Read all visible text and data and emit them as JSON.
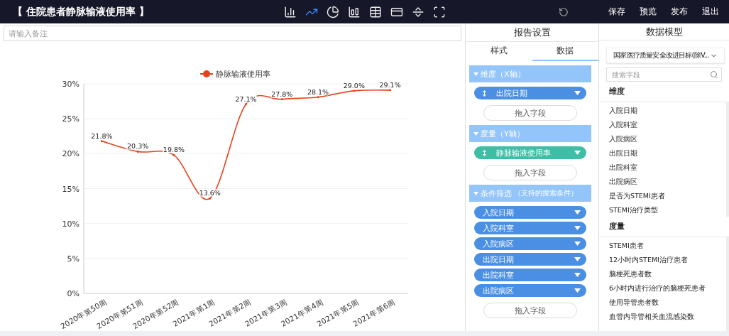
{
  "header": {
    "title": "【 住院患者静脉输液使用率 】",
    "toolbar_icons": [
      {
        "kind": "bar",
        "selected": false
      },
      {
        "kind": "line",
        "selected": true
      },
      {
        "kind": "pie",
        "selected": false
      },
      {
        "kind": "combo",
        "selected": false
      },
      {
        "kind": "table",
        "selected": false
      },
      {
        "kind": "card",
        "selected": false
      },
      {
        "kind": "split",
        "selected": false
      },
      {
        "kind": "frame",
        "selected": false
      }
    ],
    "actions": [
      "保存",
      "预览",
      "发布",
      "退出"
    ]
  },
  "remark": {
    "placeholder": "请输入备注"
  },
  "chart": {
    "chart_data": {
      "type": "line",
      "categories": [
        "2020年第50周",
        "2020年第51周",
        "2020年第52周",
        "2021年第1周",
        "2021年第2周",
        "2021年第3周",
        "2021年第4周",
        "2021年第5周",
        "2021年第6周"
      ],
      "series": [
        {
          "name": "静脉输液使用率",
          "color": "#e8401c",
          "values": [
            21.8,
            20.3,
            19.8,
            13.6,
            27.1,
            27.8,
            28.1,
            29.0,
            29.1
          ]
        }
      ],
      "ylim": [
        0,
        30
      ],
      "yticks": [
        {
          "value": 0,
          "label": "0%"
        },
        {
          "value": 5,
          "label": "5%"
        },
        {
          "value": 10,
          "label": "10%"
        },
        {
          "value": 15,
          "label": "15%"
        },
        {
          "value": 20,
          "label": "20%"
        },
        {
          "value": 25,
          "label": "25%"
        },
        {
          "value": 30,
          "label": "30%"
        }
      ],
      "grid": true,
      "value_labels": [
        "21.8%",
        "20.3%",
        "19.8%",
        "13.6%",
        "27.1%",
        "27.8%",
        "28.1%",
        "29.0%",
        "29.1%"
      ]
    }
  },
  "report_settings": {
    "title": "报告设置",
    "tabs": [
      {
        "label": "样式",
        "selected": false
      },
      {
        "label": "数据",
        "selected": true
      }
    ],
    "sections": [
      {
        "title": "维度（X轴）",
        "fields": [
          {
            "label": "出院日期",
            "kind": "dimension",
            "handle": true
          }
        ],
        "drop": "拖入字段"
      },
      {
        "title": "度量（Y轴）",
        "fields": [
          {
            "label": "静脉输液使用率",
            "kind": "measure",
            "handle": true
          }
        ],
        "drop": "拖入字段"
      },
      {
        "title": "条件筛选",
        "note": "（支持的搜索条件）",
        "fields": [
          {
            "label": "入院日期",
            "kind": "dimension",
            "handle": false
          },
          {
            "label": "入院科室",
            "kind": "dimension",
            "handle": false
          },
          {
            "label": "入院病区",
            "kind": "dimension",
            "handle": false
          },
          {
            "label": "出院日期",
            "kind": "dimension",
            "handle": false
          },
          {
            "label": "出院科室",
            "kind": "dimension",
            "handle": false
          },
          {
            "label": "出院病区",
            "kind": "dimension",
            "handle": false
          }
        ],
        "drop": "拖入字段"
      }
    ]
  },
  "data_model": {
    "title": "数据模型",
    "source": "国家医疗质量安全改进目标(除V...",
    "search": {
      "placeholder": "搜索字段"
    },
    "groups": [
      {
        "title": "维度",
        "items": [
          "入院日期",
          "入院科室",
          "入院病区",
          "出院日期",
          "出院科室",
          "出院病区",
          "是否为STEMI患者",
          "STEMI治疗类型"
        ]
      },
      {
        "title": "度量",
        "items": [
          "STEMI患者",
          "12小时内STEMI治疗患者",
          "脑梗死患者数",
          "6小时内进行治疗的脑梗死患者",
          "使用导管患者数",
          "血管内导管相关血流感染数"
        ]
      }
    ]
  }
}
